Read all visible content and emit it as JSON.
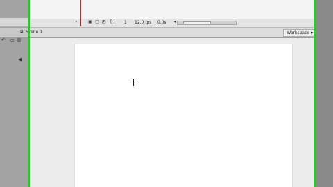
{
  "timeline": {
    "current_frame": "1",
    "fps": "12.0 fps",
    "elapsed": "0.0s",
    "icons": [
      "onion-skin-icon",
      "onion-outline-icon",
      "edit-multiple-frames-icon",
      "modify-markers-icon"
    ]
  },
  "editbar": {
    "scene_label": "Scene 1",
    "workspace_label": "Workspace ▾"
  },
  "colors": {
    "green_guide": "#19d219",
    "playhead": "#d12020",
    "stage": "#ffffff",
    "pasteboard": "#ececec"
  }
}
